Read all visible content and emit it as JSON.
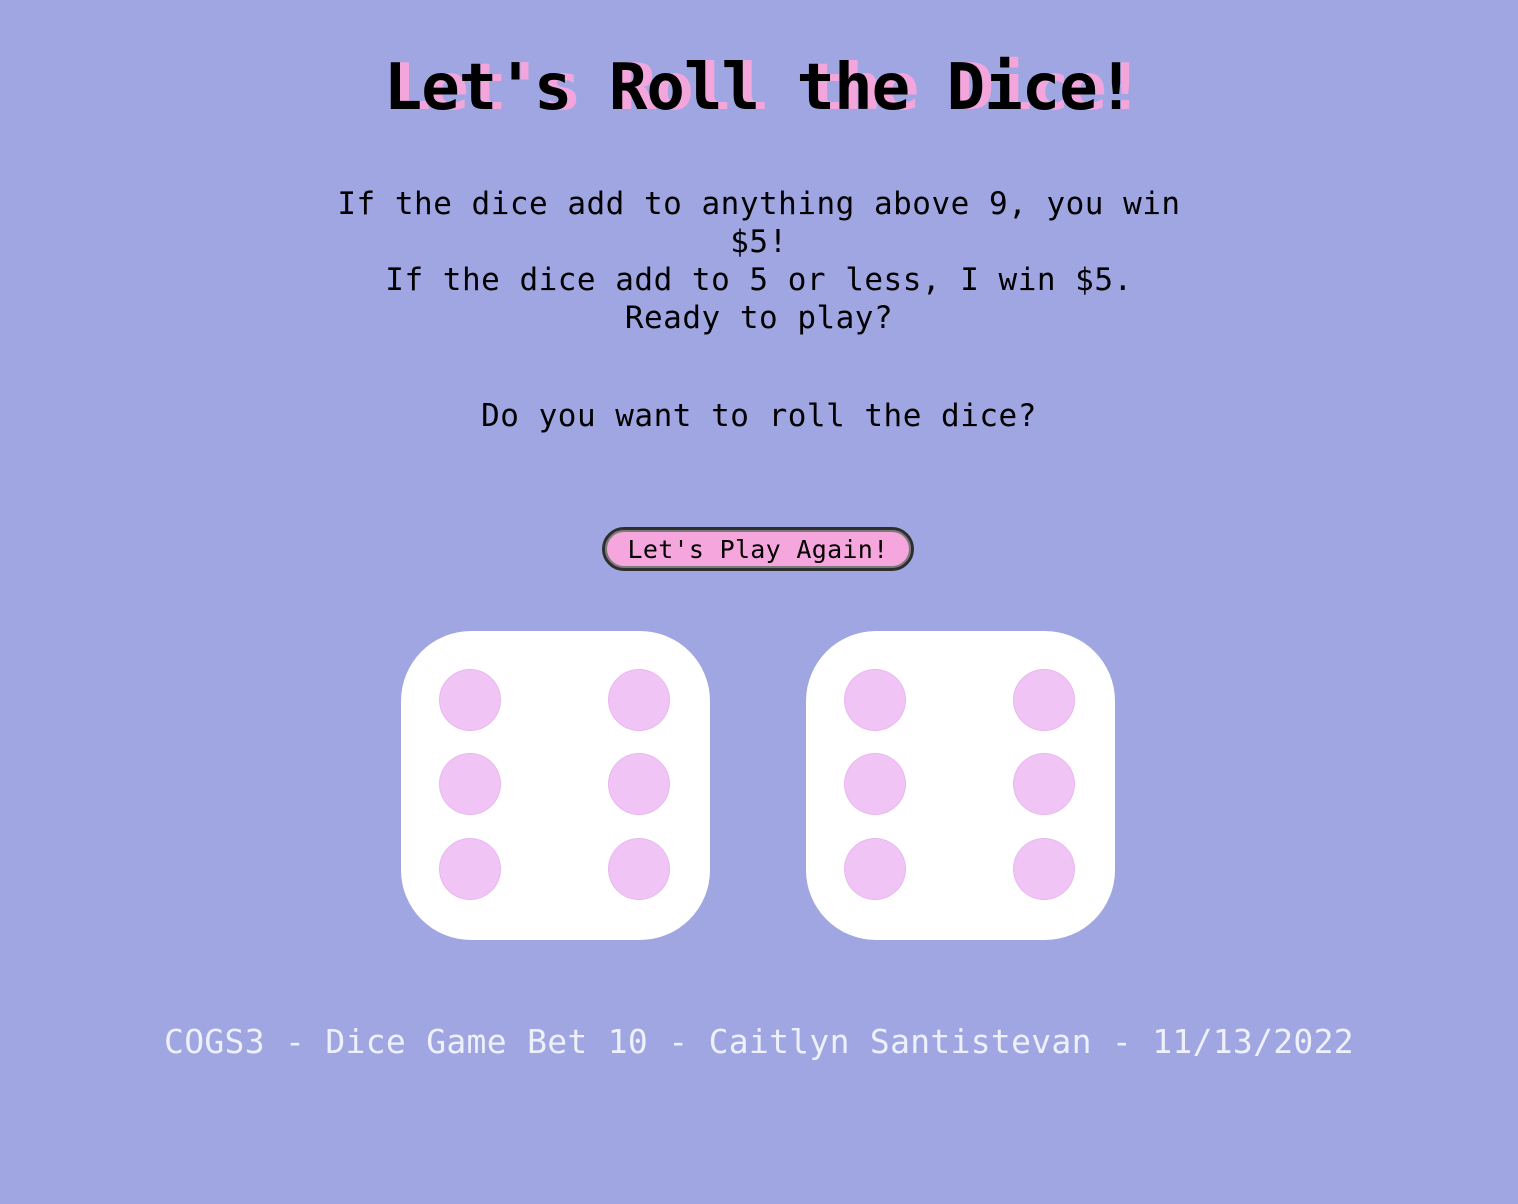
{
  "page": {
    "title": "Let's Roll the Dice!",
    "rules": [
      "If the dice add to anything above 9, you win $5!",
      "If the dice add to 5 or less, I win $5.",
      "Ready to play?"
    ],
    "prompt": "Do you want to roll the dice?",
    "play_button_label": "Let's Play Again!",
    "footer": "COGS3 - Dice Game Bet 10 - Caitlyn Santistevan - 11/13/2022"
  },
  "dice": [
    {
      "value": 6
    },
    {
      "value": 6
    }
  ],
  "colors": {
    "background": "#9fa6e2",
    "title_shadow": "#f2a6dc",
    "button": "#f5a6dc",
    "die_face": "#ffffff",
    "pip": "#f1c4f6",
    "footer_text": "#eef0fb"
  }
}
